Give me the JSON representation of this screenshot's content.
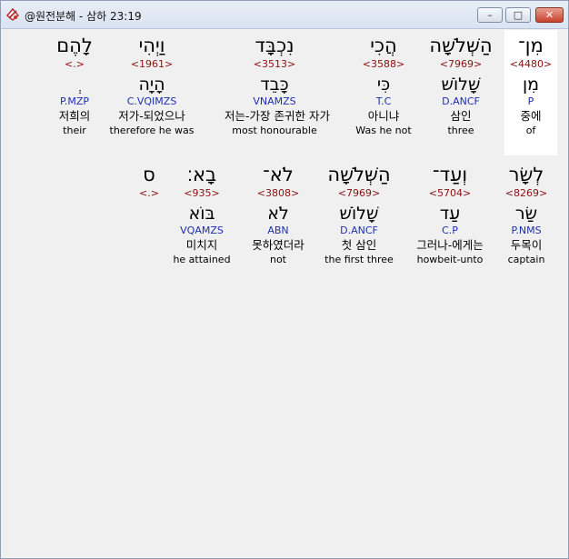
{
  "window": {
    "title": "@원전분해 - 삼하 23:19",
    "minimize_glyph": "–",
    "maximize_glyph": "□",
    "close_glyph": "✕"
  },
  "rows": [
    {
      "words": [
        {
          "hebrew": "מִן־",
          "strongs": "<4480>",
          "lemma": "מִן",
          "parse": "P",
          "korean": "중에",
          "english": "of"
        },
        {
          "hebrew": "הַשְּׁלֹשָׁה",
          "strongs": "<7969>",
          "lemma": "שָׁלוֹשׁ",
          "parse": "D.ANCF",
          "korean": "삼인",
          "english": "three"
        },
        {
          "hebrew": "הֲכִי",
          "strongs": "<3588>",
          "lemma": "כִּי",
          "parse": "T.C",
          "korean": "아니냐",
          "english": "Was he not"
        },
        {
          "hebrew": "נִכְבָּד",
          "strongs": "<3513>",
          "lemma": "כָּבֵד",
          "parse": "VNAMZS",
          "korean": "저는-가장 존귀한 자가",
          "english": "most honourable"
        },
        {
          "hebrew": "וַיְהִי",
          "strongs": "<1961>",
          "lemma": "הָיָה",
          "parse": "C.VQIMZS",
          "korean": "저가-되었으나",
          "english": "therefore he was"
        },
        {
          "hebrew": "לָהֶם",
          "strongs": "<.>",
          "lemma": "ְ",
          "parse": "P.MZP",
          "korean": "저희의",
          "english": "their"
        }
      ]
    },
    {
      "words": [
        {
          "hebrew": "לְשָׂר",
          "strongs": "<8269>",
          "lemma": "שַׂר",
          "parse": "P.NMS",
          "korean": "두목이",
          "english": "captain"
        },
        {
          "hebrew": "וְעַד־",
          "strongs": "<5704>",
          "lemma": "עַד",
          "parse": "C.P",
          "korean": "그러나-에게는",
          "english": "howbeit-unto"
        },
        {
          "hebrew": "הַשְּׁלֹשָׁה",
          "strongs": "<7969>",
          "lemma": "שָׁלוֹשׁ",
          "parse": "D.ANCF",
          "korean": "첫 삼인",
          "english": "the first three"
        },
        {
          "hebrew": "לֹא־",
          "strongs": "<3808>",
          "lemma": "לֹא",
          "parse": "ABN",
          "korean": "못하였더라",
          "english": "not"
        },
        {
          "hebrew": "בָא׃",
          "strongs": "<935>",
          "lemma": "בּוֹא",
          "parse": "VQAMZS",
          "korean": "미치지",
          "english": "he attained"
        },
        {
          "hebrew": "ס",
          "strongs": "<.>",
          "lemma": "",
          "parse": "",
          "korean": "",
          "english": ""
        }
      ]
    }
  ]
}
